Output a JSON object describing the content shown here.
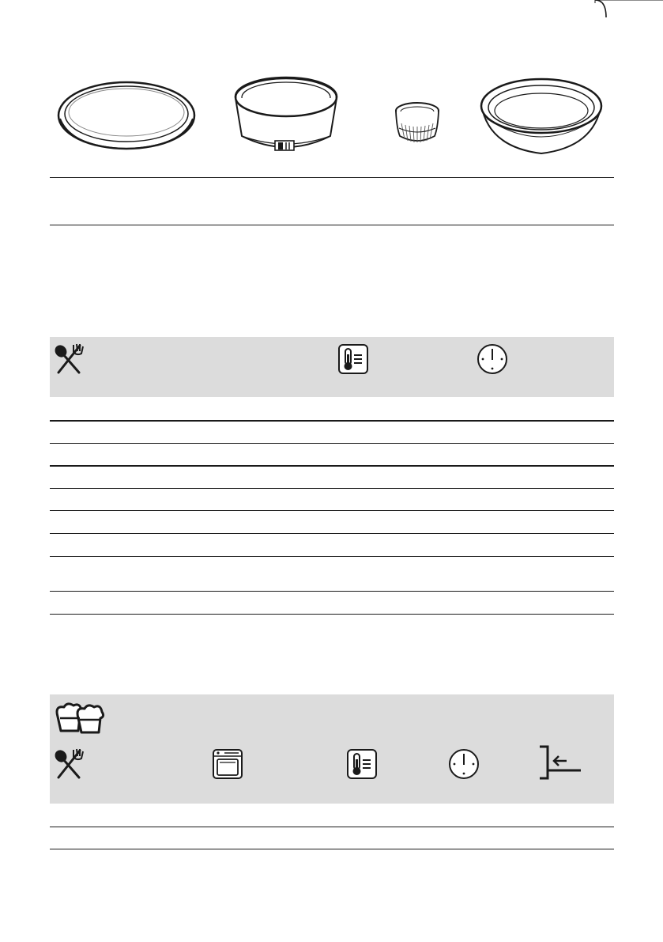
{
  "page": {
    "background": "#ffffff",
    "line_color": "#1a1a1a",
    "band_color": "#dcdcdc"
  },
  "dishes": [
    {
      "icon": "flat-tart-pan-icon"
    },
    {
      "icon": "springform-pan-icon"
    },
    {
      "icon": "ramekin-icon"
    },
    {
      "icon": "deep-round-pan-icon"
    }
  ],
  "table1": {
    "header_icons": [
      "food-utensils-icon",
      "temperature-icon",
      "clock-icon"
    ],
    "row_count": 8
  },
  "table2": {
    "category_icon": "muffins-icon",
    "header_icons": [
      "food-utensils-icon",
      "oven-function-icon",
      "temperature-icon",
      "clock-icon",
      "shelf-position-icon"
    ],
    "row_count": 2
  }
}
